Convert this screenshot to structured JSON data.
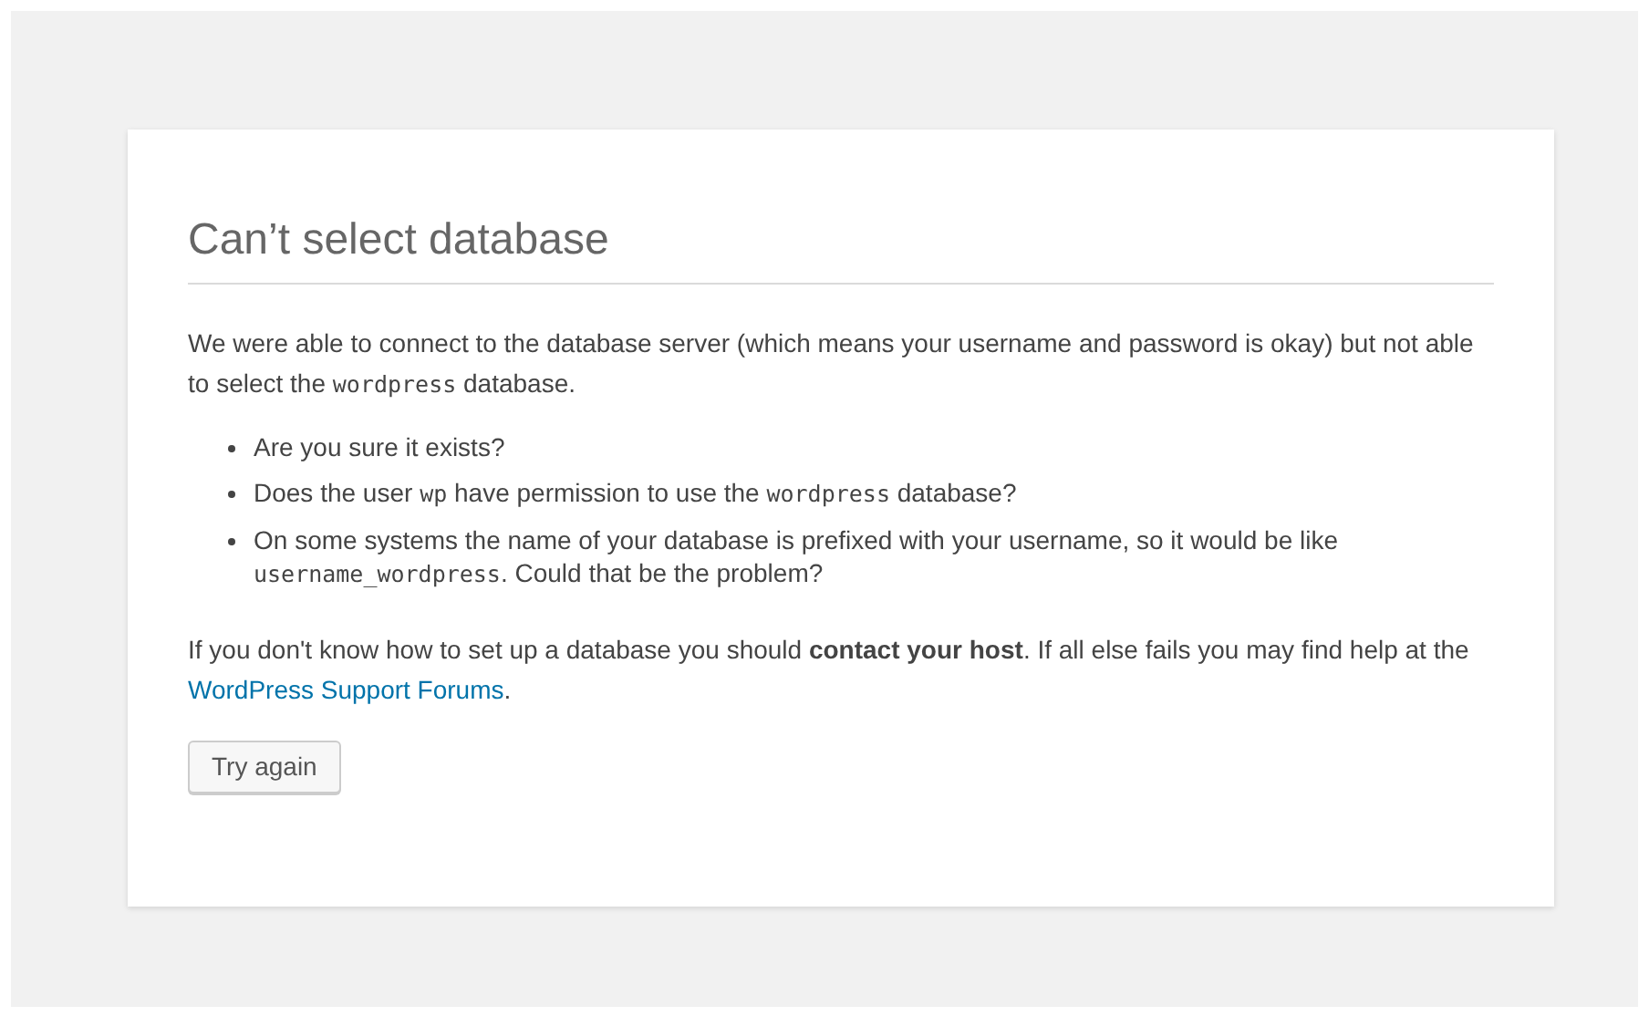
{
  "heading": "Can’t select database",
  "intro": [
    {
      "kind": "text",
      "text": "We were able to connect to the database server (which means your username and password is okay) but not able to select the "
    },
    {
      "kind": "code",
      "text": "wordpress"
    },
    {
      "kind": "text",
      "text": " database."
    }
  ],
  "checks": [
    [
      {
        "kind": "text",
        "text": "Are you sure it exists?"
      }
    ],
    [
      {
        "kind": "text",
        "text": "Does the user "
      },
      {
        "kind": "code",
        "text": "wp"
      },
      {
        "kind": "text",
        "text": " have permission to use the "
      },
      {
        "kind": "code",
        "text": "wordpress"
      },
      {
        "kind": "text",
        "text": " database?"
      }
    ],
    [
      {
        "kind": "text",
        "text": "On some systems the name of your database is prefixed with your username, so it would be like "
      },
      {
        "kind": "code",
        "text": "username_wordpress"
      },
      {
        "kind": "text",
        "text": ". Could that be the problem?"
      }
    ]
  ],
  "help": [
    {
      "kind": "text",
      "text": "If you don't know how to set up a database you should "
    },
    {
      "kind": "bold",
      "text": "contact your host"
    },
    {
      "kind": "text",
      "text": ". If all else fails you may find help at the "
    },
    {
      "kind": "link",
      "text": "WordPress Support Forums"
    },
    {
      "kind": "text",
      "text": "."
    }
  ],
  "button": "Try again"
}
